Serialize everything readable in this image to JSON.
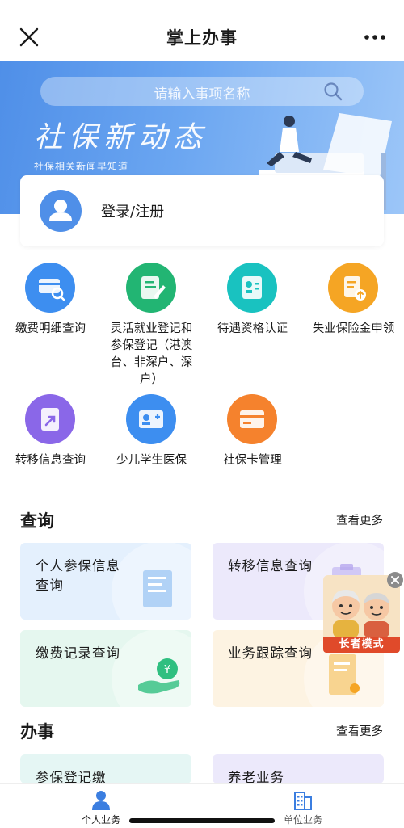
{
  "nav": {
    "title": "掌上办事"
  },
  "search": {
    "placeholder": "请输入事项名称"
  },
  "banner": {
    "title": "社保新动态",
    "subtitle": "社保相关新闻早知道"
  },
  "login": {
    "label": "登录/注册"
  },
  "services": [
    {
      "label": "缴费明细查询",
      "icon": "card-search-icon",
      "color": "#3d8ef0"
    },
    {
      "label": "灵活就业登记和参保登记（港澳台、非深户、深户）",
      "icon": "form-edit-icon",
      "color": "#22b573"
    },
    {
      "label": "待遇资格认证",
      "icon": "id-badge-icon",
      "color": "#19c2c0"
    },
    {
      "label": "失业保险金申领",
      "icon": "document-upload-icon",
      "color": "#f5a524"
    },
    {
      "label": "转移信息查询",
      "icon": "transfer-arrow-icon",
      "color": "#8a67e8"
    },
    {
      "label": "少儿学生医保",
      "icon": "student-card-icon",
      "color": "#3d8ef0"
    },
    {
      "label": "社保卡管理",
      "icon": "bank-card-icon",
      "color": "#f5822d"
    }
  ],
  "query_section": {
    "title": "查询",
    "more": "查看更多",
    "cards": [
      {
        "label": "个人参保信息查询",
        "bg": "#e4f0fd",
        "icon": "insurance-doc-icon"
      },
      {
        "label": "转移信息查询",
        "bg": "#ece9fb",
        "icon": "clipboard-icon"
      },
      {
        "label": "缴费记录查询",
        "bg": "#e5f7ef",
        "icon": "coin-hand-icon"
      },
      {
        "label": "业务跟踪查询",
        "bg": "#fdf3e2",
        "icon": "tracking-doc-icon"
      }
    ]
  },
  "handle_section": {
    "title": "办事",
    "more": "查看更多",
    "cards": [
      {
        "label": "参保登记缴",
        "bg": "#e5f6f4"
      },
      {
        "label": "养老业务",
        "bg": "#ece9fb"
      }
    ]
  },
  "elder_mode": {
    "label": "长者模式"
  },
  "tabbar": {
    "personal": "个人业务",
    "company": "单位业务"
  }
}
